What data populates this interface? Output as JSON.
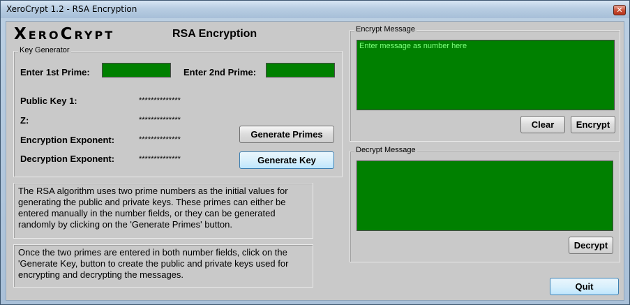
{
  "window": {
    "title": "XeroCrypt 1.2 - RSA Encryption",
    "close_glyph": "✕"
  },
  "header": {
    "logo_x": "X",
    "logo_ero": "ERO",
    "logo_c": "C",
    "logo_rypt": "RYPT",
    "subtitle": "RSA Encryption"
  },
  "key_generator": {
    "legend": "Key Generator",
    "prime1_label": "Enter 1st Prime:",
    "prime1_value": "",
    "prime2_label": "Enter 2nd Prime:",
    "prime2_value": "",
    "public_key_label": "Public Key 1:",
    "public_key_value": "**************",
    "z_label": "Z:",
    "z_value": "**************",
    "enc_exp_label": "Encryption Exponent:",
    "enc_exp_value": "**************",
    "dec_exp_label": "Decryption Exponent:",
    "dec_exp_value": "**************",
    "generate_primes_label": "Generate Primes",
    "generate_key_label": "Generate Key"
  },
  "info": {
    "paragraph1": "The RSA algorithm uses two prime numbers as the initial values for generating the public and private keys. These primes can either be entered manually in the number fields, or they can be generated randomly by clicking on the 'Generate Primes' button.",
    "paragraph2": "Once the two primes are entered in both number fields, click on the 'Generate Key, button to create the public and private keys used for encrypting and decrypting the messages."
  },
  "encrypt": {
    "legend": "Encrypt Message",
    "placeholder": "Enter message as number here",
    "clear_label": "Clear",
    "encrypt_label": "Encrypt"
  },
  "decrypt": {
    "legend": "Decrypt Message",
    "value": "",
    "decrypt_label": "Decrypt"
  },
  "footer": {
    "quit_label": "Quit"
  },
  "colors": {
    "field_bg": "#008000",
    "placeholder_text": "#7cff7c",
    "panel_bg": "#c9c9c9"
  }
}
